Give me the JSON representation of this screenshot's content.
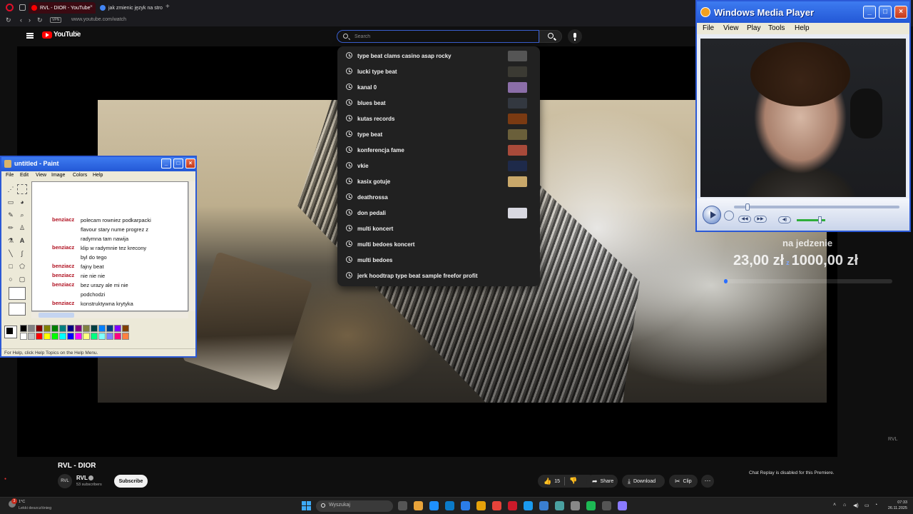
{
  "browser": {
    "tabs": [
      {
        "label": "RVL - DIOR - YouTube",
        "active": true
      },
      {
        "label": "jak zmienic język na stro",
        "active": false
      }
    ],
    "vpn_badge": "VPN",
    "url": "www.youtube.com/watch"
  },
  "youtube": {
    "logo_text": "YouTube",
    "country_code": "PL",
    "search_placeholder": "Search",
    "suggestions": [
      {
        "text": "type beat clams casino asap rocky",
        "thumb": "#555"
      },
      {
        "text": "lucki type beat",
        "thumb": "#3b3a33"
      },
      {
        "text": "kanal 0",
        "thumb": "#8b6ea8"
      },
      {
        "text": "blues beat",
        "thumb": "#333840"
      },
      {
        "text": "kutas records",
        "thumb": "#7a3a12"
      },
      {
        "text": "type beat",
        "thumb": "#6a5f3a"
      },
      {
        "text": "konferencja fame",
        "thumb": "#a84a3a"
      },
      {
        "text": "vkie",
        "thumb": "#1e2a4a"
      },
      {
        "text": "kasix gotuje",
        "thumb": "#c9a86a"
      },
      {
        "text": "deathrossa",
        "thumb": null
      },
      {
        "text": "don pedali",
        "thumb": "#d8d8e0"
      },
      {
        "text": "multi koncert",
        "thumb": null
      },
      {
        "text": "multi bedoes koncert",
        "thumb": null
      },
      {
        "text": "multi bedoes",
        "thumb": null
      },
      {
        "text": "jerk hoodtrap type beat sample freefor profit",
        "thumb": null
      }
    ],
    "video": {
      "overlay_label": "na jedzenie",
      "overlay_amount_current": "23,00 zł",
      "overlay_separator": "z",
      "overlay_amount_goal": "1000,00 zł",
      "goal_progress": 0.023,
      "title": "RVL - DIOR",
      "channel_name": "RVL",
      "channel_avatar_text": "RVL",
      "subscribers": "53 subscribers",
      "subscribe_label": "Subscribe",
      "likes": "15",
      "share_label": "Share",
      "download_label": "Download",
      "clip_label": "Clip",
      "more_label": "···",
      "chat_replay_text": "Chat Replay is disabled for this Premiere."
    }
  },
  "wmp": {
    "title": "Windows Media Player",
    "menu": [
      "File",
      "View",
      "Play",
      "Tools",
      "Help"
    ]
  },
  "paint": {
    "title": "untitled - Paint",
    "menu": [
      "File",
      "Edit",
      "View",
      "Image",
      "Colors",
      "Help"
    ],
    "chat": [
      {
        "user": "benziacz",
        "lines": [
          "polecam rowniez podkarpacki",
          "flavour stary nume progrez z",
          "radymna tam nawija"
        ]
      },
      {
        "user": "benziacz",
        "lines": [
          "klip w radymnie tez krecony",
          "byl do tego"
        ]
      },
      {
        "user": "benziacz",
        "lines": [
          "fajny beat"
        ]
      },
      {
        "user": "benziacz",
        "lines": [
          "nie nie nie"
        ]
      },
      {
        "user": "benziacz",
        "lines": [
          "bez urazy ale mi nie",
          "podchodzi"
        ]
      },
      {
        "user": "benziacz",
        "lines": [
          "konstruktywna krytyka"
        ]
      }
    ],
    "status": "For Help, click Help Topics on the Help Menu.",
    "palette": [
      "#000000",
      "#808080",
      "#800000",
      "#808000",
      "#008000",
      "#008080",
      "#000080",
      "#800080",
      "#808040",
      "#004040",
      "#0080ff",
      "#004080",
      "#8000ff",
      "#804000",
      "#ffffff",
      "#c0c0c0",
      "#ff0000",
      "#ffff00",
      "#00ff00",
      "#00ffff",
      "#0000ff",
      "#ff00ff",
      "#ffff80",
      "#00ff80",
      "#80ffff",
      "#8080ff",
      "#ff0080",
      "#ff8040"
    ]
  },
  "taskbar": {
    "weather_badge": "3",
    "weather_temp": "1°C",
    "weather_desc": "Lekki deszcz/śnieg",
    "search_placeholder": "Wyszukaj",
    "apps": [
      "#555",
      "#e8a33a",
      "#1e90ff",
      "#0a7ac8",
      "#2b7de9",
      "#e6a20a",
      "#e8433a",
      "#cc1a2a",
      "#1a9aef",
      "#3a7ed0",
      "#4aa0a0",
      "#888",
      "#1db954",
      "#555",
      "#8a7aff"
    ],
    "time": "07:33",
    "date": "26.11.2025"
  }
}
